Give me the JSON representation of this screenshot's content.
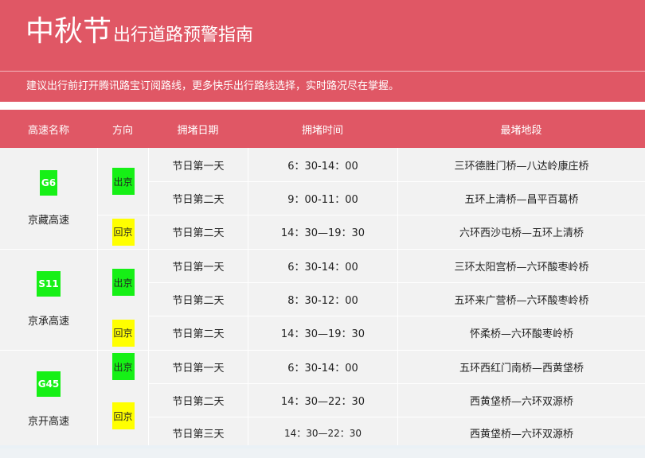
{
  "header": {
    "title_main": "中秋节",
    "title_sub": "出行道路预警指南",
    "notice": "建议出行前打开腾讯路宝订阅路线，更多快乐出行路线选择，实时路况尽在掌握。"
  },
  "table": {
    "columns": [
      "高速名称",
      "方向",
      "拥堵日期",
      "拥堵时间",
      "最堵地段"
    ],
    "highways": [
      {
        "code": "G6",
        "name": "京藏高速"
      },
      {
        "code": "S11",
        "name": "京承高速"
      },
      {
        "code": "G45",
        "name": "京开高速"
      }
    ],
    "directions": [
      {
        "label": "出京",
        "kind": "out"
      },
      {
        "label": "回京",
        "kind": "back"
      },
      {
        "label": "出京",
        "kind": "out"
      },
      {
        "label": "回京",
        "kind": "back"
      },
      {
        "label": "出京",
        "kind": "out"
      },
      {
        "label": "回京",
        "kind": "back"
      }
    ],
    "rows": [
      {
        "date": "节日第一天",
        "time": "6：30-14：00",
        "section": "三环德胜门桥—八达岭康庄桥"
      },
      {
        "date": "节日第二天",
        "time": "9：00-11：00",
        "section": "五环上清桥—昌平百葛桥"
      },
      {
        "date": "节日第二天",
        "time": "14：30—19：30",
        "section": "六环西沙屯桥—五环上清桥"
      },
      {
        "date": "节日第一天",
        "time": "6：30-14：00",
        "section": "三环太阳宫桥—六环酸枣岭桥"
      },
      {
        "date": "节日第二天",
        "time": "8：30-12：00",
        "section": "五环来广营桥—六环酸枣岭桥"
      },
      {
        "date": "节日第二天",
        "time": "14：30—19：30",
        "section": "怀柔桥—六环酸枣岭桥"
      },
      {
        "date": "节日第一天",
        "time": "6：30-14：00",
        "section": "五环西红门南桥—西黄垡桥"
      },
      {
        "date": "节日第二天",
        "time": "14：30—22：30",
        "section": "西黄垡桥—六环双源桥"
      },
      {
        "date": "节日第三天",
        "time": "14：30—22：30",
        "section": "西黄垡桥—六环双源桥"
      }
    ]
  },
  "colors": {
    "brand": "#e05765",
    "outbound": "#16f016",
    "inbound": "#ffff00"
  }
}
